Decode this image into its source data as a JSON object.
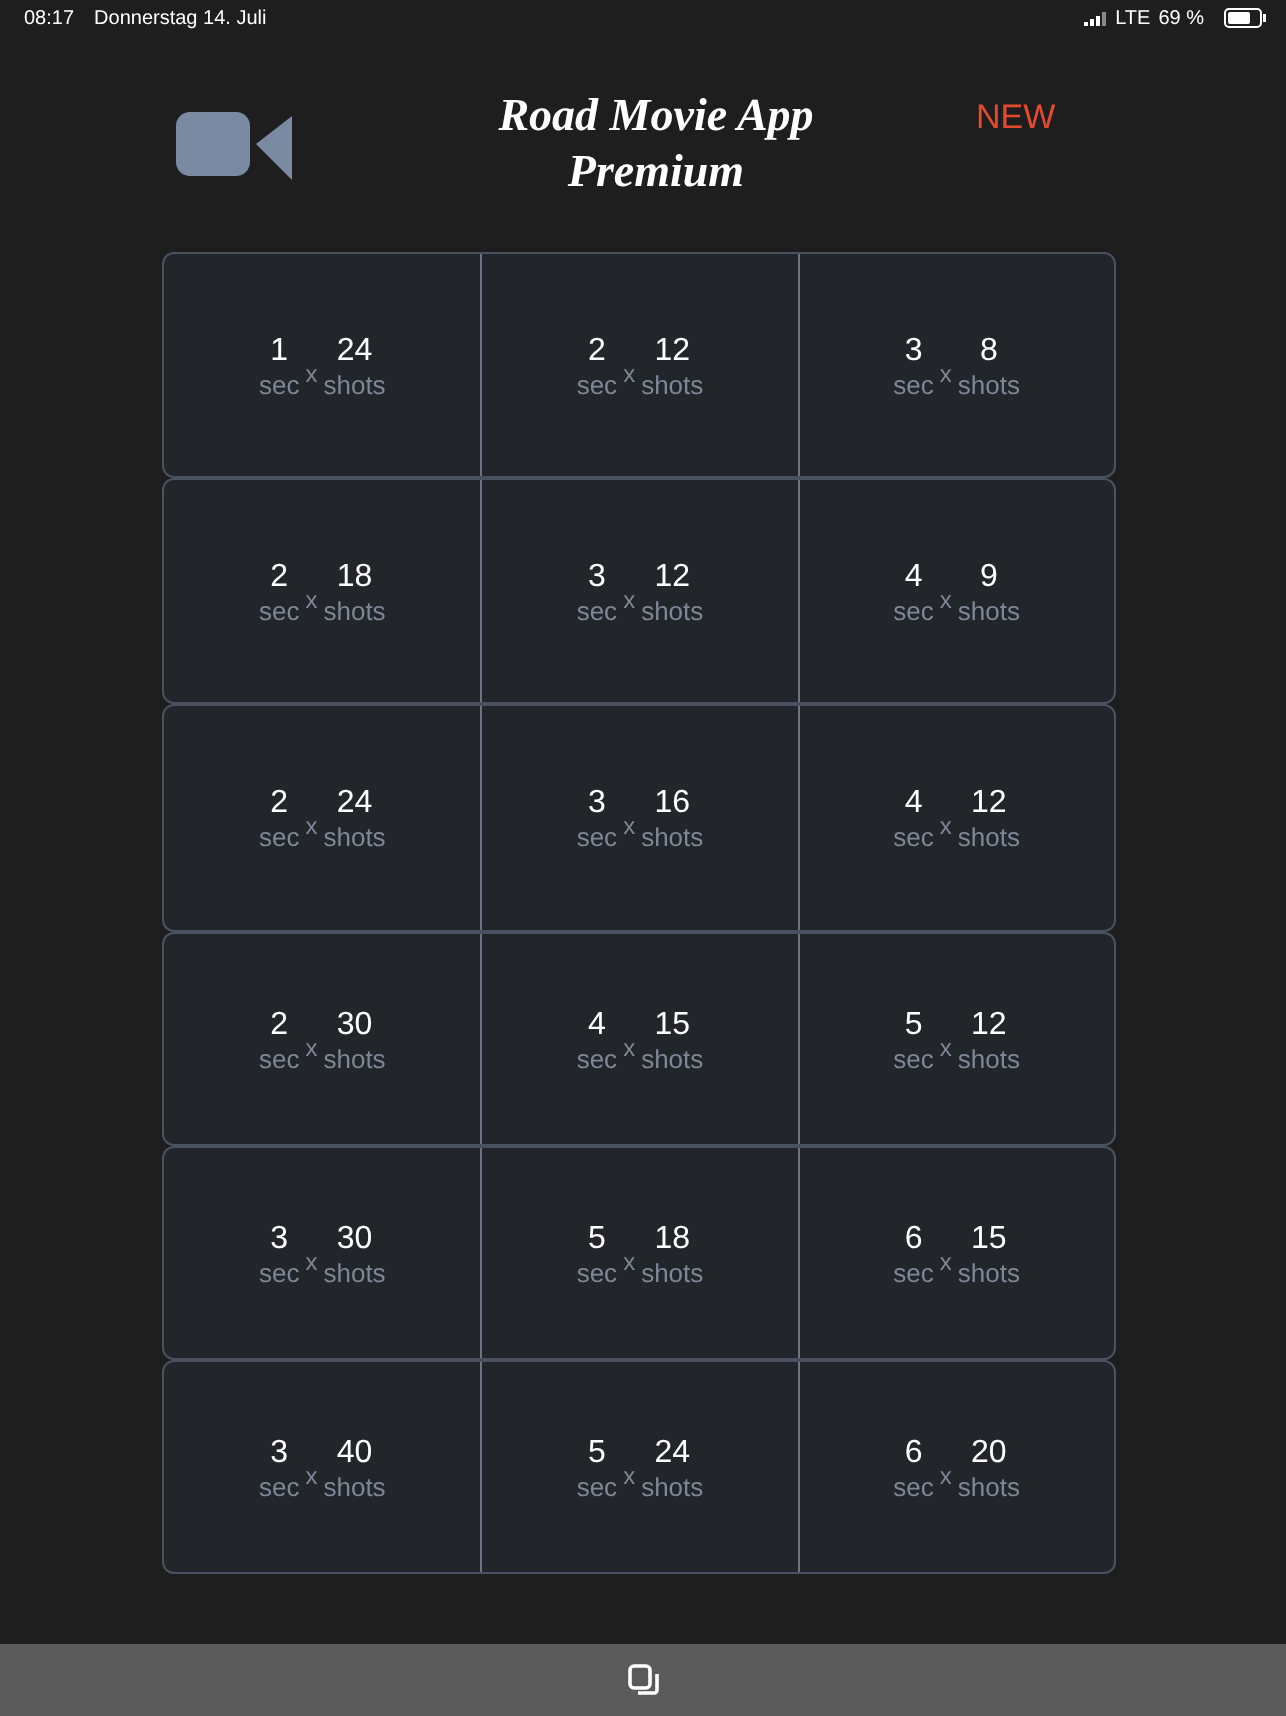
{
  "status_bar": {
    "time": "08:17",
    "date": "Donnerstag 14. Juli",
    "network": "LTE",
    "battery": "69 %"
  },
  "header": {
    "title_lines": [
      "Road Movie App",
      "Premium"
    ],
    "badge": "NEW"
  },
  "rows": [
    [
      {
        "seconds": "1",
        "shots": "24",
        "sec_label": "sec",
        "times": "x",
        "shots_label": "shots"
      },
      {
        "seconds": "2",
        "shots": "12",
        "sec_label": "sec",
        "times": "x",
        "shots_label": "shots"
      },
      {
        "seconds": "3",
        "shots": "8",
        "sec_label": "sec",
        "times": "x",
        "shots_label": "shots"
      }
    ],
    [
      {
        "seconds": "2",
        "shots": "18",
        "sec_label": "sec",
        "times": "x",
        "shots_label": "shots"
      },
      {
        "seconds": "3",
        "shots": "12",
        "sec_label": "sec",
        "times": "x",
        "shots_label": "shots"
      },
      {
        "seconds": "4",
        "shots": "9",
        "sec_label": "sec",
        "times": "x",
        "shots_label": "shots"
      }
    ],
    [
      {
        "seconds": "2",
        "shots": "24",
        "sec_label": "sec",
        "times": "x",
        "shots_label": "shots"
      },
      {
        "seconds": "3",
        "shots": "16",
        "sec_label": "sec",
        "times": "x",
        "shots_label": "shots"
      },
      {
        "seconds": "4",
        "shots": "12",
        "sec_label": "sec",
        "times": "x",
        "shots_label": "shots"
      }
    ],
    [
      {
        "seconds": "2",
        "shots": "30",
        "sec_label": "sec",
        "times": "x",
        "shots_label": "shots"
      },
      {
        "seconds": "4",
        "shots": "15",
        "sec_label": "sec",
        "times": "x",
        "shots_label": "shots"
      },
      {
        "seconds": "5",
        "shots": "12",
        "sec_label": "sec",
        "times": "x",
        "shots_label": "shots"
      }
    ],
    [
      {
        "seconds": "3",
        "shots": "30",
        "sec_label": "sec",
        "times": "x",
        "shots_label": "shots"
      },
      {
        "seconds": "5",
        "shots": "18",
        "sec_label": "sec",
        "times": "x",
        "shots_label": "shots"
      },
      {
        "seconds": "6",
        "shots": "15",
        "sec_label": "sec",
        "times": "x",
        "shots_label": "shots"
      }
    ],
    [
      {
        "seconds": "3",
        "shots": "40",
        "sec_label": "sec",
        "times": "x",
        "shots_label": "shots"
      },
      {
        "seconds": "5",
        "shots": "24",
        "sec_label": "sec",
        "times": "x",
        "shots_label": "shots"
      },
      {
        "seconds": "6",
        "shots": "20",
        "sec_label": "sec",
        "times": "x",
        "shots_label": "shots"
      }
    ]
  ]
}
